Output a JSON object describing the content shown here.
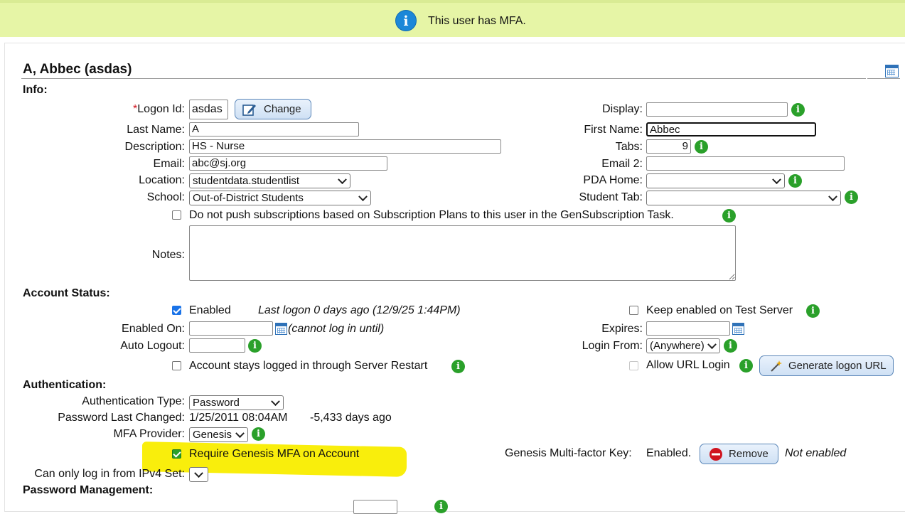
{
  "banner": {
    "message": "This user has MFA."
  },
  "user": {
    "title": "A, Abbec (asdas)"
  },
  "info": {
    "section_label": "Info:",
    "logon_id_required_mark": "*",
    "logon_id_label": "Logon Id:",
    "logon_id_value": "asdas",
    "change_label": "Change",
    "last_name_label": "Last Name:",
    "last_name_value": "A",
    "description_label": "Description:",
    "description_value": "HS - Nurse",
    "email_label": "Email:",
    "email_value": "abc@sj.org",
    "location_label": "Location:",
    "location_value": "studentdata.studentlist",
    "school_label": "School:",
    "school_value": "Out-of-District Students",
    "display_label": "Display:",
    "display_value": "",
    "first_name_label": "First Name:",
    "first_name_value": "Abbec",
    "tabs_label": "Tabs:",
    "tabs_value": "9",
    "email2_label": "Email 2:",
    "email2_value": "",
    "pda_home_label": "PDA Home:",
    "pda_home_value": "",
    "student_tab_label": "Student Tab:",
    "student_tab_value": "",
    "no_push_label": "Do not push subscriptions based on Subscription Plans to this user in the GenSubscription Task.",
    "notes_label": "Notes:",
    "notes_value": ""
  },
  "account_status": {
    "section_label": "Account Status:",
    "enabled_label": "Enabled",
    "last_logon": "Last logon 0 days ago (12/9/25 1:44PM)",
    "keep_enabled_label": "Keep enabled on Test Server",
    "enabled_on_label": "Enabled On:",
    "enabled_on_value": "",
    "cannot_log_in_note": "(cannot log in until)",
    "expires_label": "Expires:",
    "expires_value": "",
    "auto_logout_label": "Auto Logout:",
    "auto_logout_value": "",
    "login_from_label": "Login From:",
    "login_from_value": "(Anywhere)",
    "stay_logged_label": "Account stays logged in through Server Restart",
    "allow_url_label": "Allow URL Login",
    "generate_url_label": "Generate logon URL"
  },
  "authentication": {
    "section_label": "Authentication:",
    "auth_type_label": "Authentication Type:",
    "auth_type_value": "Password",
    "pw_changed_label": "Password Last Changed:",
    "pw_changed_value": "1/25/2011 08:04AM",
    "pw_changed_ago": "-5,433 days ago",
    "mfa_provider_label": "MFA Provider:",
    "mfa_provider_value": "Genesis",
    "require_mfa_label": "Require Genesis MFA on Account",
    "mfa_key_label": "Genesis Multi-factor Key:",
    "mfa_key_value": "Enabled.",
    "remove_label": "Remove",
    "not_enabled": "Not enabled",
    "ipv4_label": "Can only log in from IPv4 Set:",
    "ipv4_value": ""
  },
  "password_management": {
    "section_label": "Password Management:"
  },
  "colors": {
    "banner_bg": "#e6f5a6",
    "info_blue": "#1c87d8",
    "info_green": "#2aa02a",
    "highlight": "#f9ee0c",
    "checkbox_blue": "#1a73e8",
    "remove_red": "#d0141f"
  },
  "icons": [
    "info-icon",
    "edit-icon",
    "calendar-icon",
    "magic-wand-icon",
    "remove-icon",
    "dropdown-caret-icon"
  ]
}
